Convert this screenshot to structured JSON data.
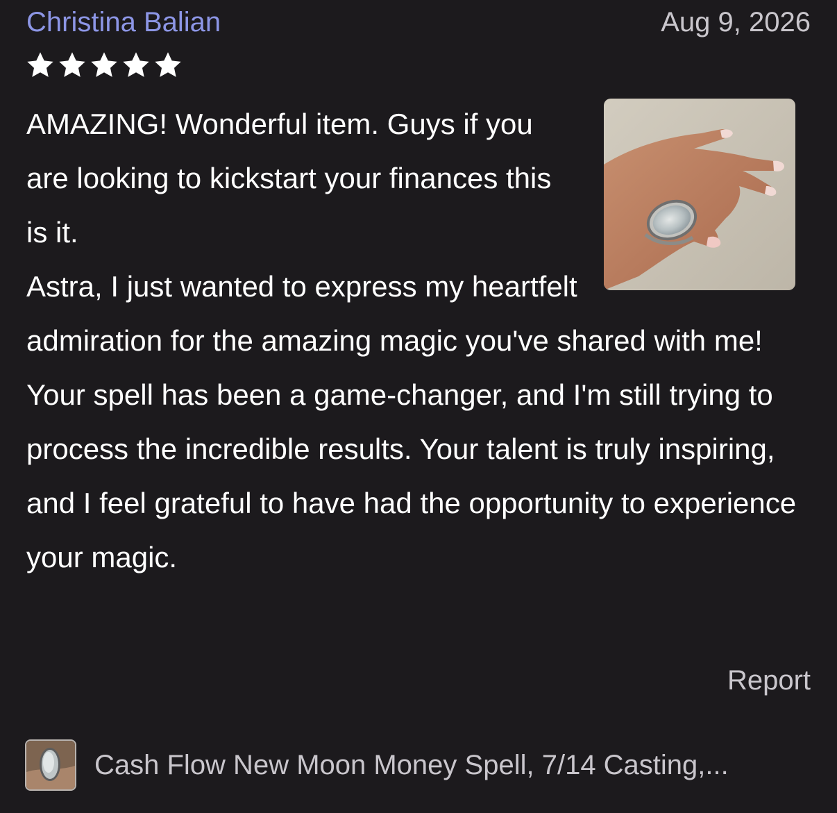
{
  "review": {
    "reviewer_name": "Christina Balian",
    "date": "Aug 9, 2026",
    "rating": 5,
    "rating_max": 5,
    "paragraphs": [
      "AMAZING! Wonderful item. Guys if you are looking to kickstart your finances this is it.",
      "Astra, I just wanted to express my heartfelt admiration for the amazing magic you've shared with me! Your spell has been a game-changer, and I'm still trying to process the incredible results. Your talent is truly inspiring, and I feel grateful to have had the opportunity to experience your magic."
    ],
    "report_label": "Report"
  },
  "listing": {
    "title": "Cash Flow New Moon Money Spell, 7/14 Casting,..."
  },
  "colors": {
    "background": "#1c1a1d",
    "reviewer_link": "#8d96e6",
    "secondary_text": "#c9c6cc",
    "body_text": "#ffffff",
    "star": "#ffffff"
  },
  "icons": {
    "star": "star-icon"
  }
}
